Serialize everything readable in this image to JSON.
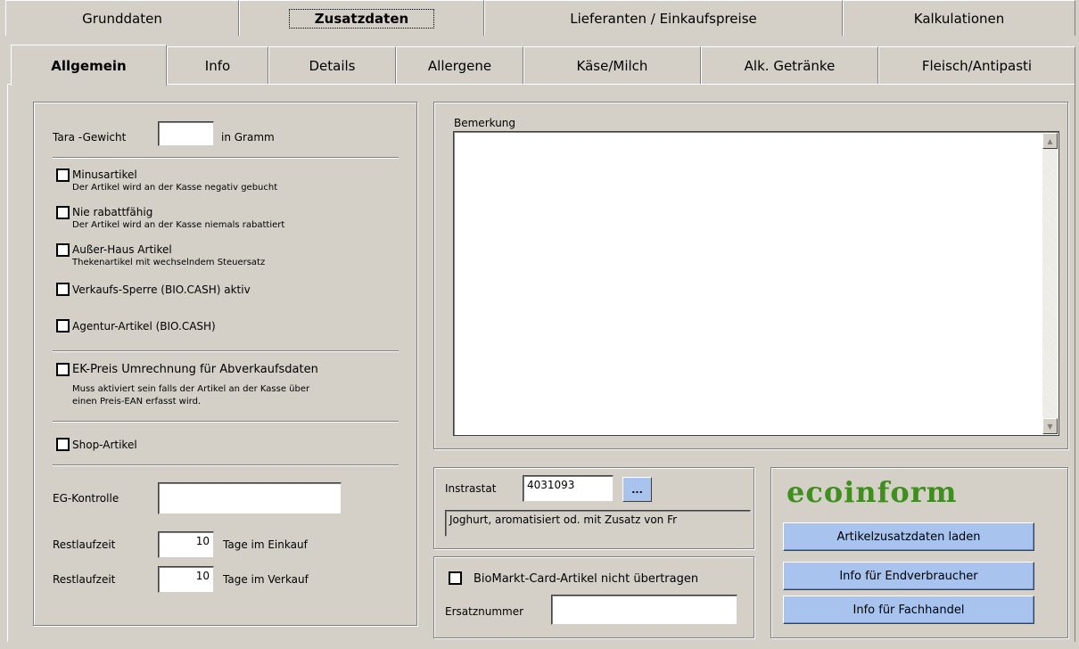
{
  "top_tabs": [
    {
      "label": "Grunddaten",
      "active": false
    },
    {
      "label": "Zusatzdaten",
      "active": true
    },
    {
      "label": "Lieferanten / Einkaufspreise",
      "active": false
    },
    {
      "label": "Kalkulationen",
      "active": false
    }
  ],
  "sub_tabs": [
    {
      "label": "Allgemein",
      "active": true
    },
    {
      "label": "Info",
      "active": false
    },
    {
      "label": "Details",
      "active": false
    },
    {
      "label": "Allergene",
      "active": false
    },
    {
      "label": "Käse/Milch",
      "active": false
    },
    {
      "label": "Alk. Getränke",
      "active": false
    },
    {
      "label": "Fleisch/Antipasti",
      "active": false
    }
  ],
  "left_panel": {
    "tara_label": "Tara -Gewicht",
    "tara_value": "",
    "tara_unit": "in Gramm",
    "checkboxes": [
      {
        "label": "Minusartikel",
        "hint": "Der Artikel wird an der Kasse negativ gebucht",
        "checked": false
      },
      {
        "label": "Nie rabattfähig",
        "hint": "Der Artikel wird an der Kasse niemals rabattiert",
        "checked": false
      },
      {
        "label": "Außer-Haus Artikel",
        "hint": "Thekenartikel mit wechselndem Steuersatz",
        "checked": false
      },
      {
        "label": "Verkaufs-Sperre (BIO.CASH) aktiv",
        "hint": "",
        "checked": false
      },
      {
        "label": "Agentur-Artikel (BIO.CASH)",
        "hint": "",
        "checked": false
      },
      {
        "label": "EK-Preis Umrechnung für Abverkaufsdaten",
        "hint": "Muss aktiviert sein falls der Artikel an der Kasse über",
        "hint2": "einen Preis-EAN erfasst wird.",
        "checked": false
      },
      {
        "label": "Shop-Artikel",
        "hint": "",
        "checked": false
      }
    ],
    "eg_label": "EG-Kontrolle",
    "eg_value": "",
    "rest1_label": "Restlaufzeit",
    "rest1_value": "10",
    "rest1_unit": "Tage im Einkauf",
    "rest2_label": "Restlaufzeit",
    "rest2_value": "10",
    "rest2_unit": "Tage im Verkauf"
  },
  "remarks": {
    "label": "Bemerkung",
    "value": ""
  },
  "intrastat": {
    "label": "Instrastat",
    "value": "4031093",
    "browse_label": "...",
    "description": "Joghurt, aromatisiert od. mit Zusatz von Fr"
  },
  "biomarkt": {
    "checkbox_label": "BioMarkt-Card-Artikel nicht übertragen",
    "checked": false,
    "ersatz_label": "Ersatznummer",
    "ersatz_value": ""
  },
  "ecoinform": {
    "logo_text": "ecoinform",
    "logo_color": "#3f8f1f",
    "btn_load": "Artikelzusatzdaten laden",
    "btn_consumer": "Info für Endverbraucher",
    "btn_trade": "Info für Fachhandel"
  },
  "colors": {
    "background": "#d4d0c8",
    "button": "#a8c4ee"
  }
}
